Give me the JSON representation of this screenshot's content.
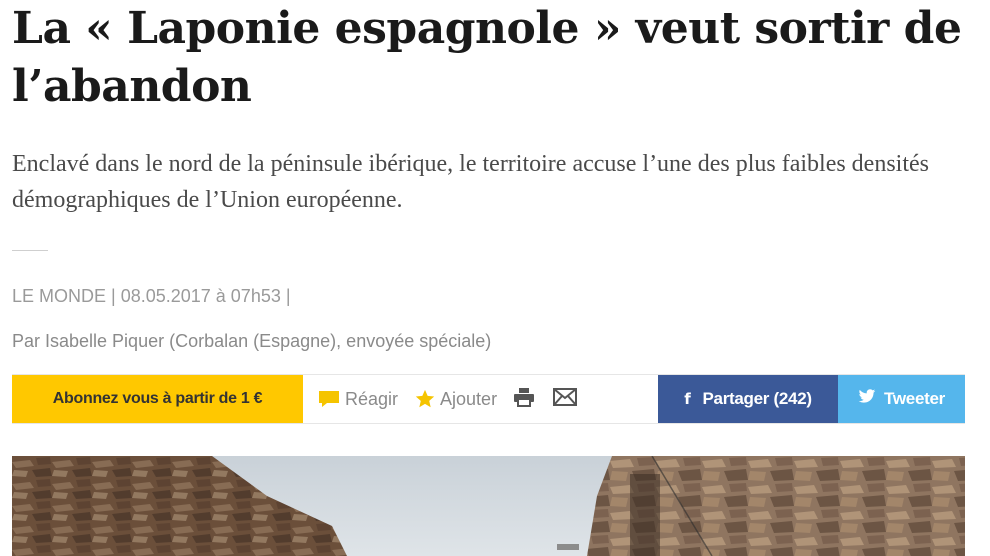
{
  "article": {
    "title": "La « Laponie espagnole » veut sortir de l’abandon",
    "lead": "Enclavé dans le nord de la péninsule ibérique, le territoire accuse l’une des plus faibles densités démographiques de l’Union européenne.",
    "meta": "LE MONDE | 08.05.2017 à 07h53 |",
    "author": "Par Isabelle Piquer (Corbalan (Espagne), envoyée spéciale)"
  },
  "toolbar": {
    "subscribe_label": "Abonnez vous à partir de 1 €",
    "react_label": "Réagir",
    "add_label": "Ajouter",
    "facebook_label": "Partager (242)",
    "facebook_letter": "f",
    "twitter_label": "Tweeter",
    "colors": {
      "subscribe": "#ffc800",
      "facebook": "#3b5998",
      "twitter": "#55b6ec",
      "icon_yellow": "#f5c400"
    },
    "icons": [
      "comment-icon",
      "star-icon",
      "print-icon",
      "mail-icon",
      "twitter-bird-icon"
    ]
  }
}
